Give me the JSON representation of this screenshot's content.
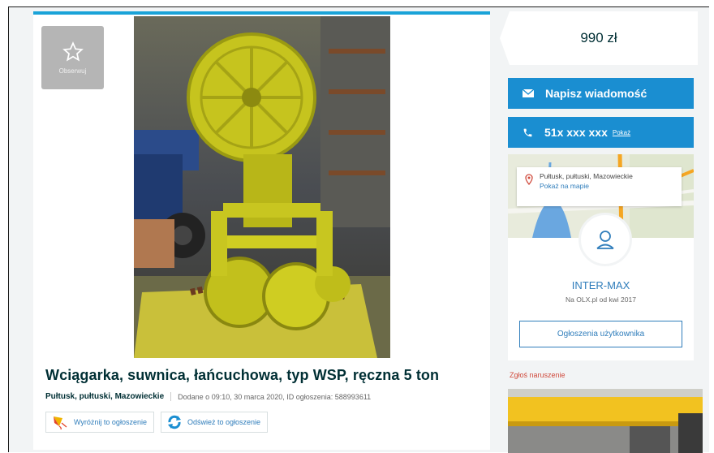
{
  "follow": {
    "label": "Obserwuj"
  },
  "listing": {
    "title": "Wciągarka, suwnica, łańcuchowa, typ WSP, ręczna 5 ton",
    "location": "Pułtusk, pułtuski, Mazowieckie",
    "added": "Dodane o 09:10, 30 marca 2020, ID ogłoszenia: 588993611"
  },
  "actions": {
    "promote": "Wyróżnij to ogłoszenie",
    "refresh": "Odśwież to ogłoszenie"
  },
  "price": "990 zł",
  "message_button": "Napisz wiadomość",
  "phone": {
    "number": "51x xxx xxx",
    "show": "Pokaż"
  },
  "map": {
    "location": "Pułtusk, pułtuski, Mazowieckie",
    "show_on_map": "Pokaż na mapie"
  },
  "seller": {
    "name": "INTER-MAX",
    "since": "Na OLX.pl od kwi 2017",
    "ads_button": "Ogłoszenia użytkownika"
  },
  "report": "Zgłoś naruszenie",
  "colors": {
    "accent_blue": "#1a8ed1",
    "link_blue": "#2f7dbb",
    "report_red": "#d04a3c",
    "text_dark": "#002f34"
  }
}
